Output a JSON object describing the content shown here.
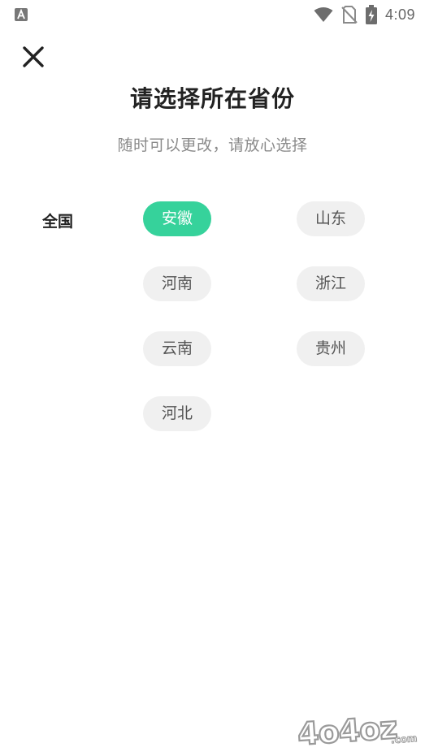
{
  "status_bar": {
    "time": "4:09",
    "icons": [
      "app-notification-icon",
      "wifi-icon",
      "no-sim-icon",
      "battery-charging-icon"
    ]
  },
  "header": {
    "close_icon": "close-icon",
    "title": "请选择所在省份",
    "subtitle": "随时可以更改，请放心选择"
  },
  "region": {
    "label": "全国"
  },
  "provinces": [
    {
      "label": "安徽",
      "selected": true
    },
    {
      "label": "山东",
      "selected": false
    },
    {
      "label": "河南",
      "selected": false
    },
    {
      "label": "浙江",
      "selected": false
    },
    {
      "label": "云南",
      "selected": false
    },
    {
      "label": "贵州",
      "selected": false
    },
    {
      "label": "河北",
      "selected": false
    }
  ],
  "colors": {
    "accent": "#36d29b",
    "chip_bg": "#f0f0f0",
    "title": "#222222",
    "subtitle": "#8a8a8a"
  },
  "watermark": {
    "text": "4o4oz.com"
  }
}
